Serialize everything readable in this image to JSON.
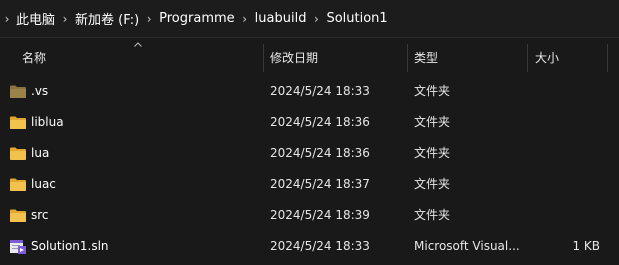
{
  "breadcrumb": {
    "items": [
      "此电脑",
      "新加卷 (F:)",
      "Programme",
      "luabuild",
      "Solution1"
    ],
    "separator": "›"
  },
  "columns": {
    "name": "名称",
    "date": "修改日期",
    "type": "类型",
    "size": "大小"
  },
  "files": [
    {
      "name": ".vs",
      "date": "2024/5/24 18:33",
      "type": "文件夹",
      "size": "",
      "icon": "folder-hidden-icon"
    },
    {
      "name": "liblua",
      "date": "2024/5/24 18:36",
      "type": "文件夹",
      "size": "",
      "icon": "folder-icon"
    },
    {
      "name": "lua",
      "date": "2024/5/24 18:36",
      "type": "文件夹",
      "size": "",
      "icon": "folder-icon"
    },
    {
      "name": "luac",
      "date": "2024/5/24 18:37",
      "type": "文件夹",
      "size": "",
      "icon": "folder-icon"
    },
    {
      "name": "src",
      "date": "2024/5/24 18:39",
      "type": "文件夹",
      "size": "",
      "icon": "folder-icon"
    },
    {
      "name": "Solution1.sln",
      "date": "2024/5/24 18:33",
      "type": "Microsoft Visual...",
      "size": "1 KB",
      "icon": "visual-studio-solution-icon"
    }
  ],
  "colors": {
    "background": "#191919",
    "folder": "#f2c14e",
    "folder_hidden": "#8a7340",
    "vs_purple": "#7b5cd6"
  }
}
